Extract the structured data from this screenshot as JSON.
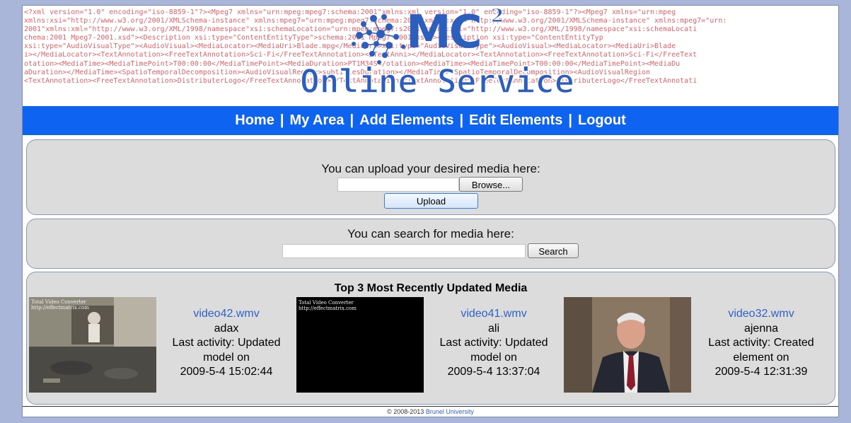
{
  "header": {
    "background_xml_lines": [
      "<?xml  version=\"1.0\"  encoding=\"iso-8859-1\"?><Mpeg7  xmlns=\"urn:mpeg:mpeg7:schema:2001\"xmlns:xml  version=\"1.0\"  encoding=\"iso-8859-1\"?><Mpeg7  xmlns=\"urn:mpeg",
      "xmlns:xsi=\"http://www.w3.org/2001/XMLSchema-instance\" xmlns:mpeg7=\"urn:mpeg:mpeg7:schema:2001\"xmlns:xsi=\"http://www.w3.org/2001/XMLSchema-instance\" xmlns:mpeg7=\"urn:",
      "2001\"xmlns:xml=\"http://www.w3.org/XML/1998/namespace\"xsi:schemaLocation=\"urn:mpeg:mpeg7:s2001\"xmlns:xml=\"http://www.w3.org/XML/1998/namespace\"xsi:schemaLocati",
      "chema:2001  Mpeg7-2001.xsd\"><Description  xsi:type=\"ContentEntityType\">schema:2001  Mpeg7-2001.xsd\"><Description  xsi:type=\"ContentEntityTyp",
      "xsi:type=\"AudioVisualType\"><AudioVisual><MediaLocator><MediaUri>Blade.mpg</MediaUri>xsi:type=\"AudioVisualType\"><AudioVisual><MediaLocator><MediaUri>Blade",
      "i></MediaLocator><TextAnnotation><FreeTextAnnotation>Sci-Fi</FreeTextAnnotation></TextAnni></MediaLocator><TextAnnotation><FreeTextAnnotation>Sci-Fi</FreeText",
      "otation><MediaTime><MediaTimePoint>T00:00:00</MediaTimePoint><MediaDuration>PT1M34S</otation><MediaTime><MediaTimePoint>T00:00:00</MediaTimePoint><MediaDu",
      "aDuration></MediaTime><SpatioTemporalDecomposition><AudioVisualRegion>subtitlesDuration></MediaTime><SpatioTemporalDecomposition><AudioVisualRegion",
      "<TextAnnotation><FreeTextAnnotation>DistributerLogo</FreeTextAnnotation></TextAnnotation><TextAnnotation><FreeTextAnnotation>DistributerLogo</FreeTextAnnotati"
    ],
    "logo_main": "MC",
    "logo_sup": "2",
    "logo_sub": "Online Service"
  },
  "nav": {
    "items": [
      "Home",
      "My Area",
      "Add Elements",
      "Edit Elements",
      "Logout"
    ],
    "separator": "|"
  },
  "upload": {
    "prompt": "You can upload your desired media here:",
    "file_value": "",
    "browse_label": "Browse...",
    "upload_label": "Upload"
  },
  "search": {
    "prompt": "You can search for media here:",
    "query_value": "",
    "search_label": "Search"
  },
  "media": {
    "title": "Top 3 Most Recently Updated Media",
    "items": [
      {
        "name": "video42.wmv",
        "user": "adax",
        "activity_lines": [
          "Last activity: Updated",
          "model on"
        ],
        "timestamp": "2009-5-4 15:02:44",
        "thumb_caption": "Total Video Converter\nhttp://effectmatrix.com"
      },
      {
        "name": "video41.wmv",
        "user": "ali",
        "activity_lines": [
          "Last activity: Updated",
          "model on"
        ],
        "timestamp": "2009-5-4 13:37:04",
        "thumb_caption": "Total Video Converter\nhttp://effectmatrix.com"
      },
      {
        "name": "video32.wmv",
        "user": "ajenna",
        "activity_lines": [
          "Last activity: Created",
          "element on"
        ],
        "timestamp": "2009-5-4 12:31:39",
        "thumb_caption": ""
      }
    ]
  },
  "footer": {
    "copyright": "© 2008-2013",
    "org": "Brunel University"
  },
  "colors": {
    "nav_bg": "#0e63f0",
    "logo_blue": "#2c5fbd",
    "link_blue": "#2f62c7",
    "panel_bg": "#dcdcdc",
    "xml_text": "#e1636a",
    "page_border_bg": "#a9b6d9"
  }
}
